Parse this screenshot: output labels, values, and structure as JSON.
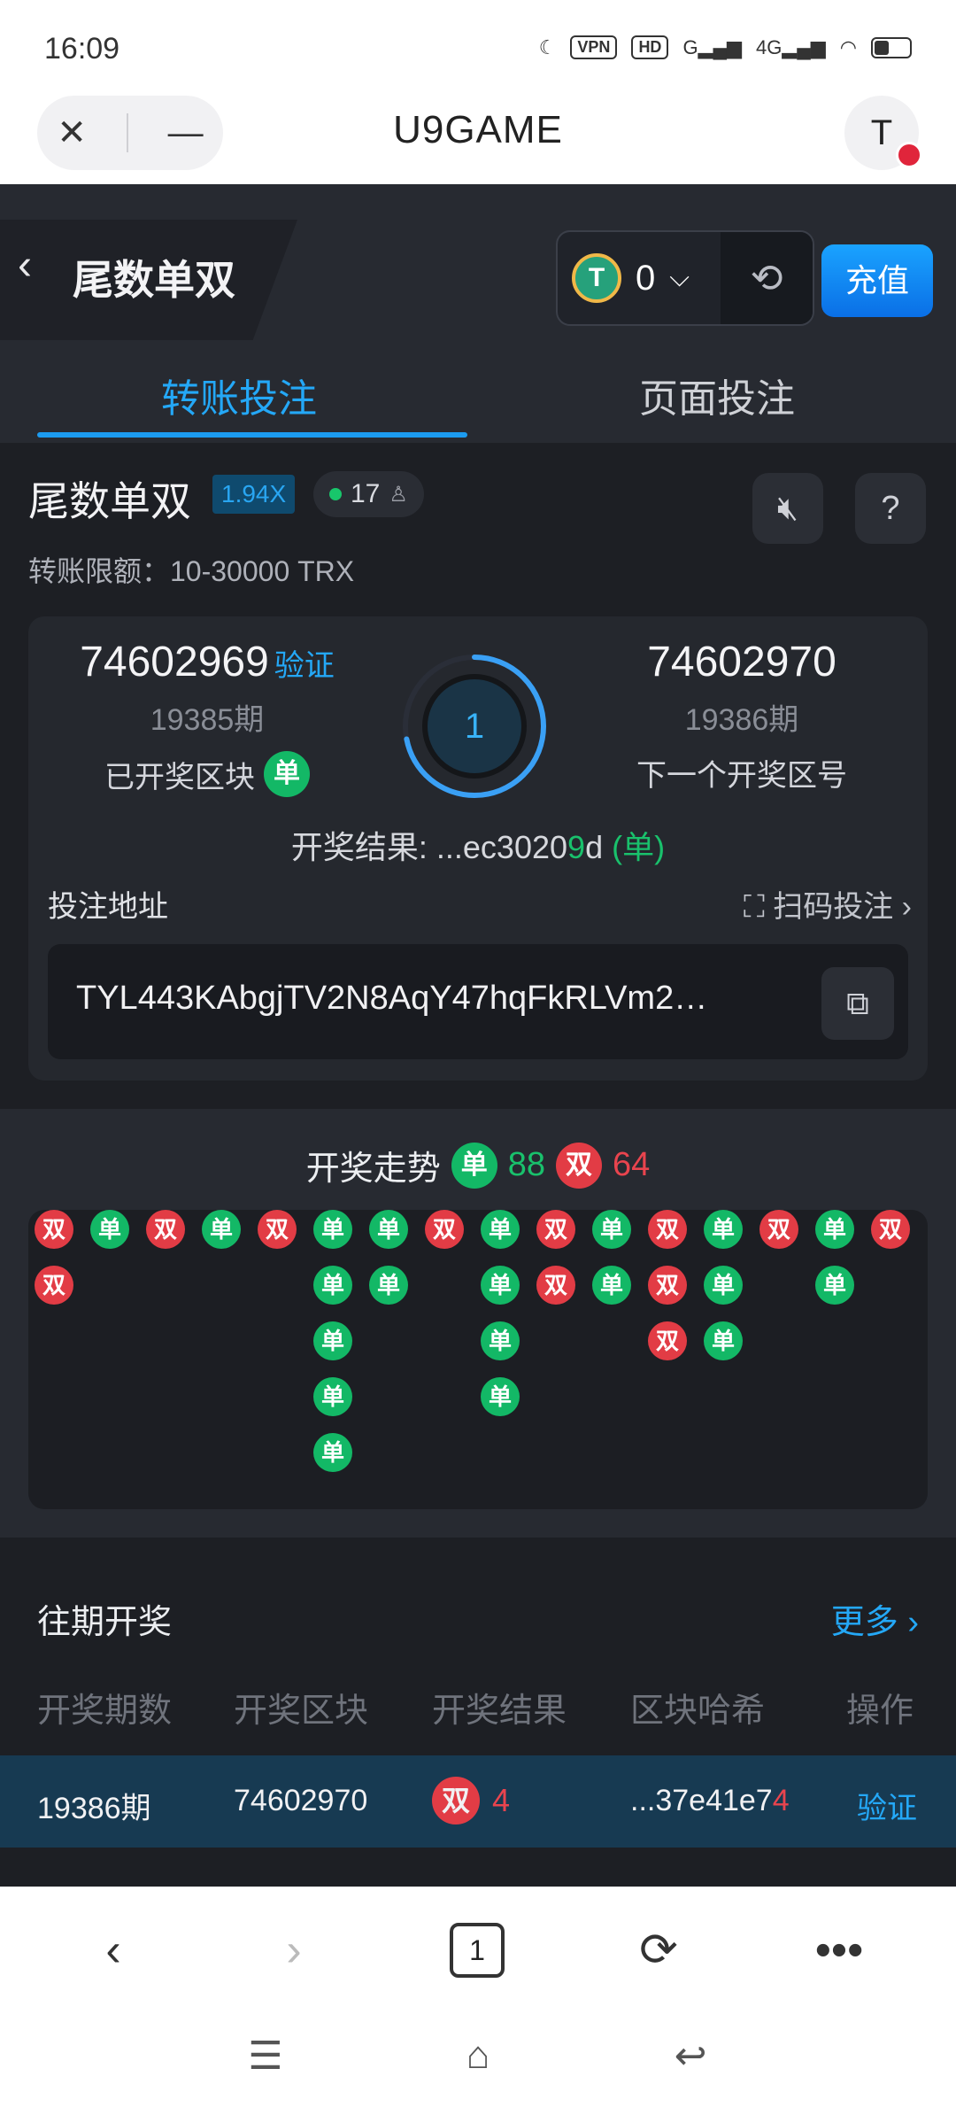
{
  "status": {
    "time": "16:09",
    "icons": [
      "moon-icon",
      "vpn-badge",
      "hd-badge",
      "signal-g",
      "signal-4g",
      "wifi-icon",
      "battery-icon"
    ],
    "vpn": "VPN",
    "hd": "HD",
    "g": "G",
    "lte": "4G"
  },
  "browser": {
    "title": "U9GAME",
    "avatar_letter": "T"
  },
  "header": {
    "title": "尾数单双",
    "wallet_amount": "0",
    "recharge_label": "充值",
    "coin_glyph": "T"
  },
  "tabs": [
    {
      "label": "转账投注",
      "active": true
    },
    {
      "label": "页面投注",
      "active": false
    }
  ],
  "game": {
    "title": "尾数单双",
    "multiplier": "1.94X",
    "online_count": "17",
    "limit": "转账限额：10-30000 TRX",
    "prev_block": "74602969",
    "verify_label": "验证",
    "prev_period": "19385期",
    "prev_label": "已开奖区块",
    "prev_result_badge": "单",
    "next_block": "74602970",
    "next_period": "19386期",
    "next_label": "下一个开奖区号",
    "countdown": "1",
    "countdown_fraction": 0.72,
    "result_prefix": "开奖结果: ",
    "result_hash_start": "...ec30",
    "result_hash_mid": "20",
    "result_hash_digit": "9",
    "result_hash_end": "d",
    "result_tag": "(单)",
    "addr_label": "投注地址",
    "scan_label": "扫码投注",
    "address": "TYL443KAbgjTV2N8AqY47hqFkRLVm2…"
  },
  "trend": {
    "title": "开奖走势",
    "odd_label": "单",
    "even_label": "双",
    "odd_count": "88",
    "even_count": "64",
    "columns": [
      [
        "双",
        "双"
      ],
      [
        "单"
      ],
      [
        "双"
      ],
      [
        "单"
      ],
      [
        "双"
      ],
      [
        "单",
        "单",
        "单",
        "单",
        "单"
      ],
      [
        "单",
        "单"
      ],
      [
        "双"
      ],
      [
        "单",
        "单",
        "单",
        "单"
      ],
      [
        "双",
        "双"
      ],
      [
        "单",
        "单"
      ],
      [
        "双",
        "双",
        "双"
      ],
      [
        "单",
        "单",
        "单"
      ],
      [
        "双"
      ],
      [
        "单",
        "单"
      ],
      [
        "双"
      ]
    ]
  },
  "history": {
    "title": "往期开奖",
    "more_label": "更多",
    "headers": [
      "开奖期数",
      "开奖区块",
      "开奖结果",
      "区块哈希",
      "操作"
    ],
    "rows": [
      {
        "period": "19386期",
        "block": "74602970",
        "badge": "双",
        "type": "even",
        "digit": "4",
        "hash": "...37e41e7",
        "hash_last": "4",
        "action": "验证"
      }
    ]
  },
  "bottom_nav": {
    "tab_count": "1"
  }
}
